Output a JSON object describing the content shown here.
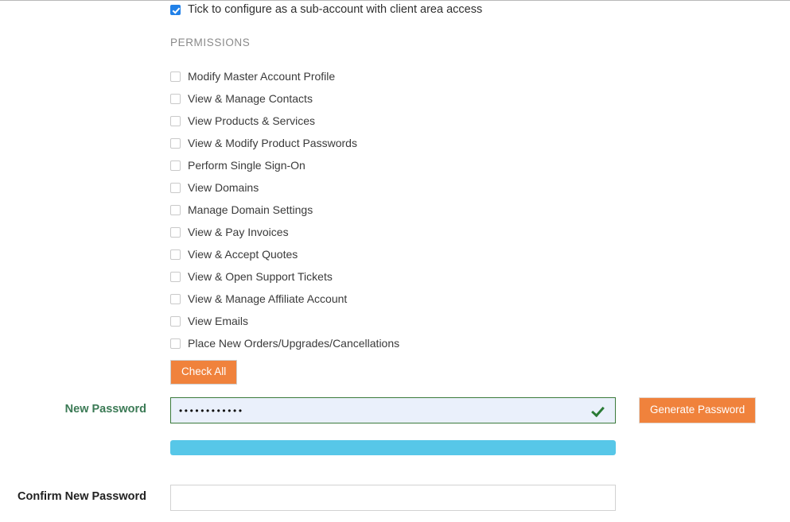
{
  "subaccount": {
    "label": "Tick to configure as a sub-account with client area access",
    "checked": true
  },
  "permissions": {
    "heading": "PERMISSIONS",
    "items": [
      {
        "label": "Modify Master Account Profile",
        "checked": false
      },
      {
        "label": "View & Manage Contacts",
        "checked": false
      },
      {
        "label": "View Products & Services",
        "checked": false
      },
      {
        "label": "View & Modify Product Passwords",
        "checked": false
      },
      {
        "label": "Perform Single Sign-On",
        "checked": false
      },
      {
        "label": "View Domains",
        "checked": false
      },
      {
        "label": "Manage Domain Settings",
        "checked": false
      },
      {
        "label": "View & Pay Invoices",
        "checked": false
      },
      {
        "label": "View & Accept Quotes",
        "checked": false
      },
      {
        "label": "View & Open Support Tickets",
        "checked": false
      },
      {
        "label": "View & Manage Affiliate Account",
        "checked": false
      },
      {
        "label": "View Emails",
        "checked": false
      },
      {
        "label": "Place New Orders/Upgrades/Cancellations",
        "checked": false
      }
    ],
    "check_all_label": "Check All"
  },
  "new_password": {
    "label": "New Password",
    "value": "••••••••••••",
    "placeholder": "",
    "valid_icon": "check-icon",
    "generate_label": "Generate Password"
  },
  "strength": {
    "percent": 100
  },
  "confirm_password": {
    "label": "Confirm New Password",
    "value": "",
    "placeholder": ""
  },
  "colors": {
    "accent_orange": "#f0823c",
    "checkbox_blue": "#2181e8",
    "valid_green": "#2a7a35",
    "label_green": "#3b7a55",
    "strength_cyan": "#57c7e8"
  }
}
